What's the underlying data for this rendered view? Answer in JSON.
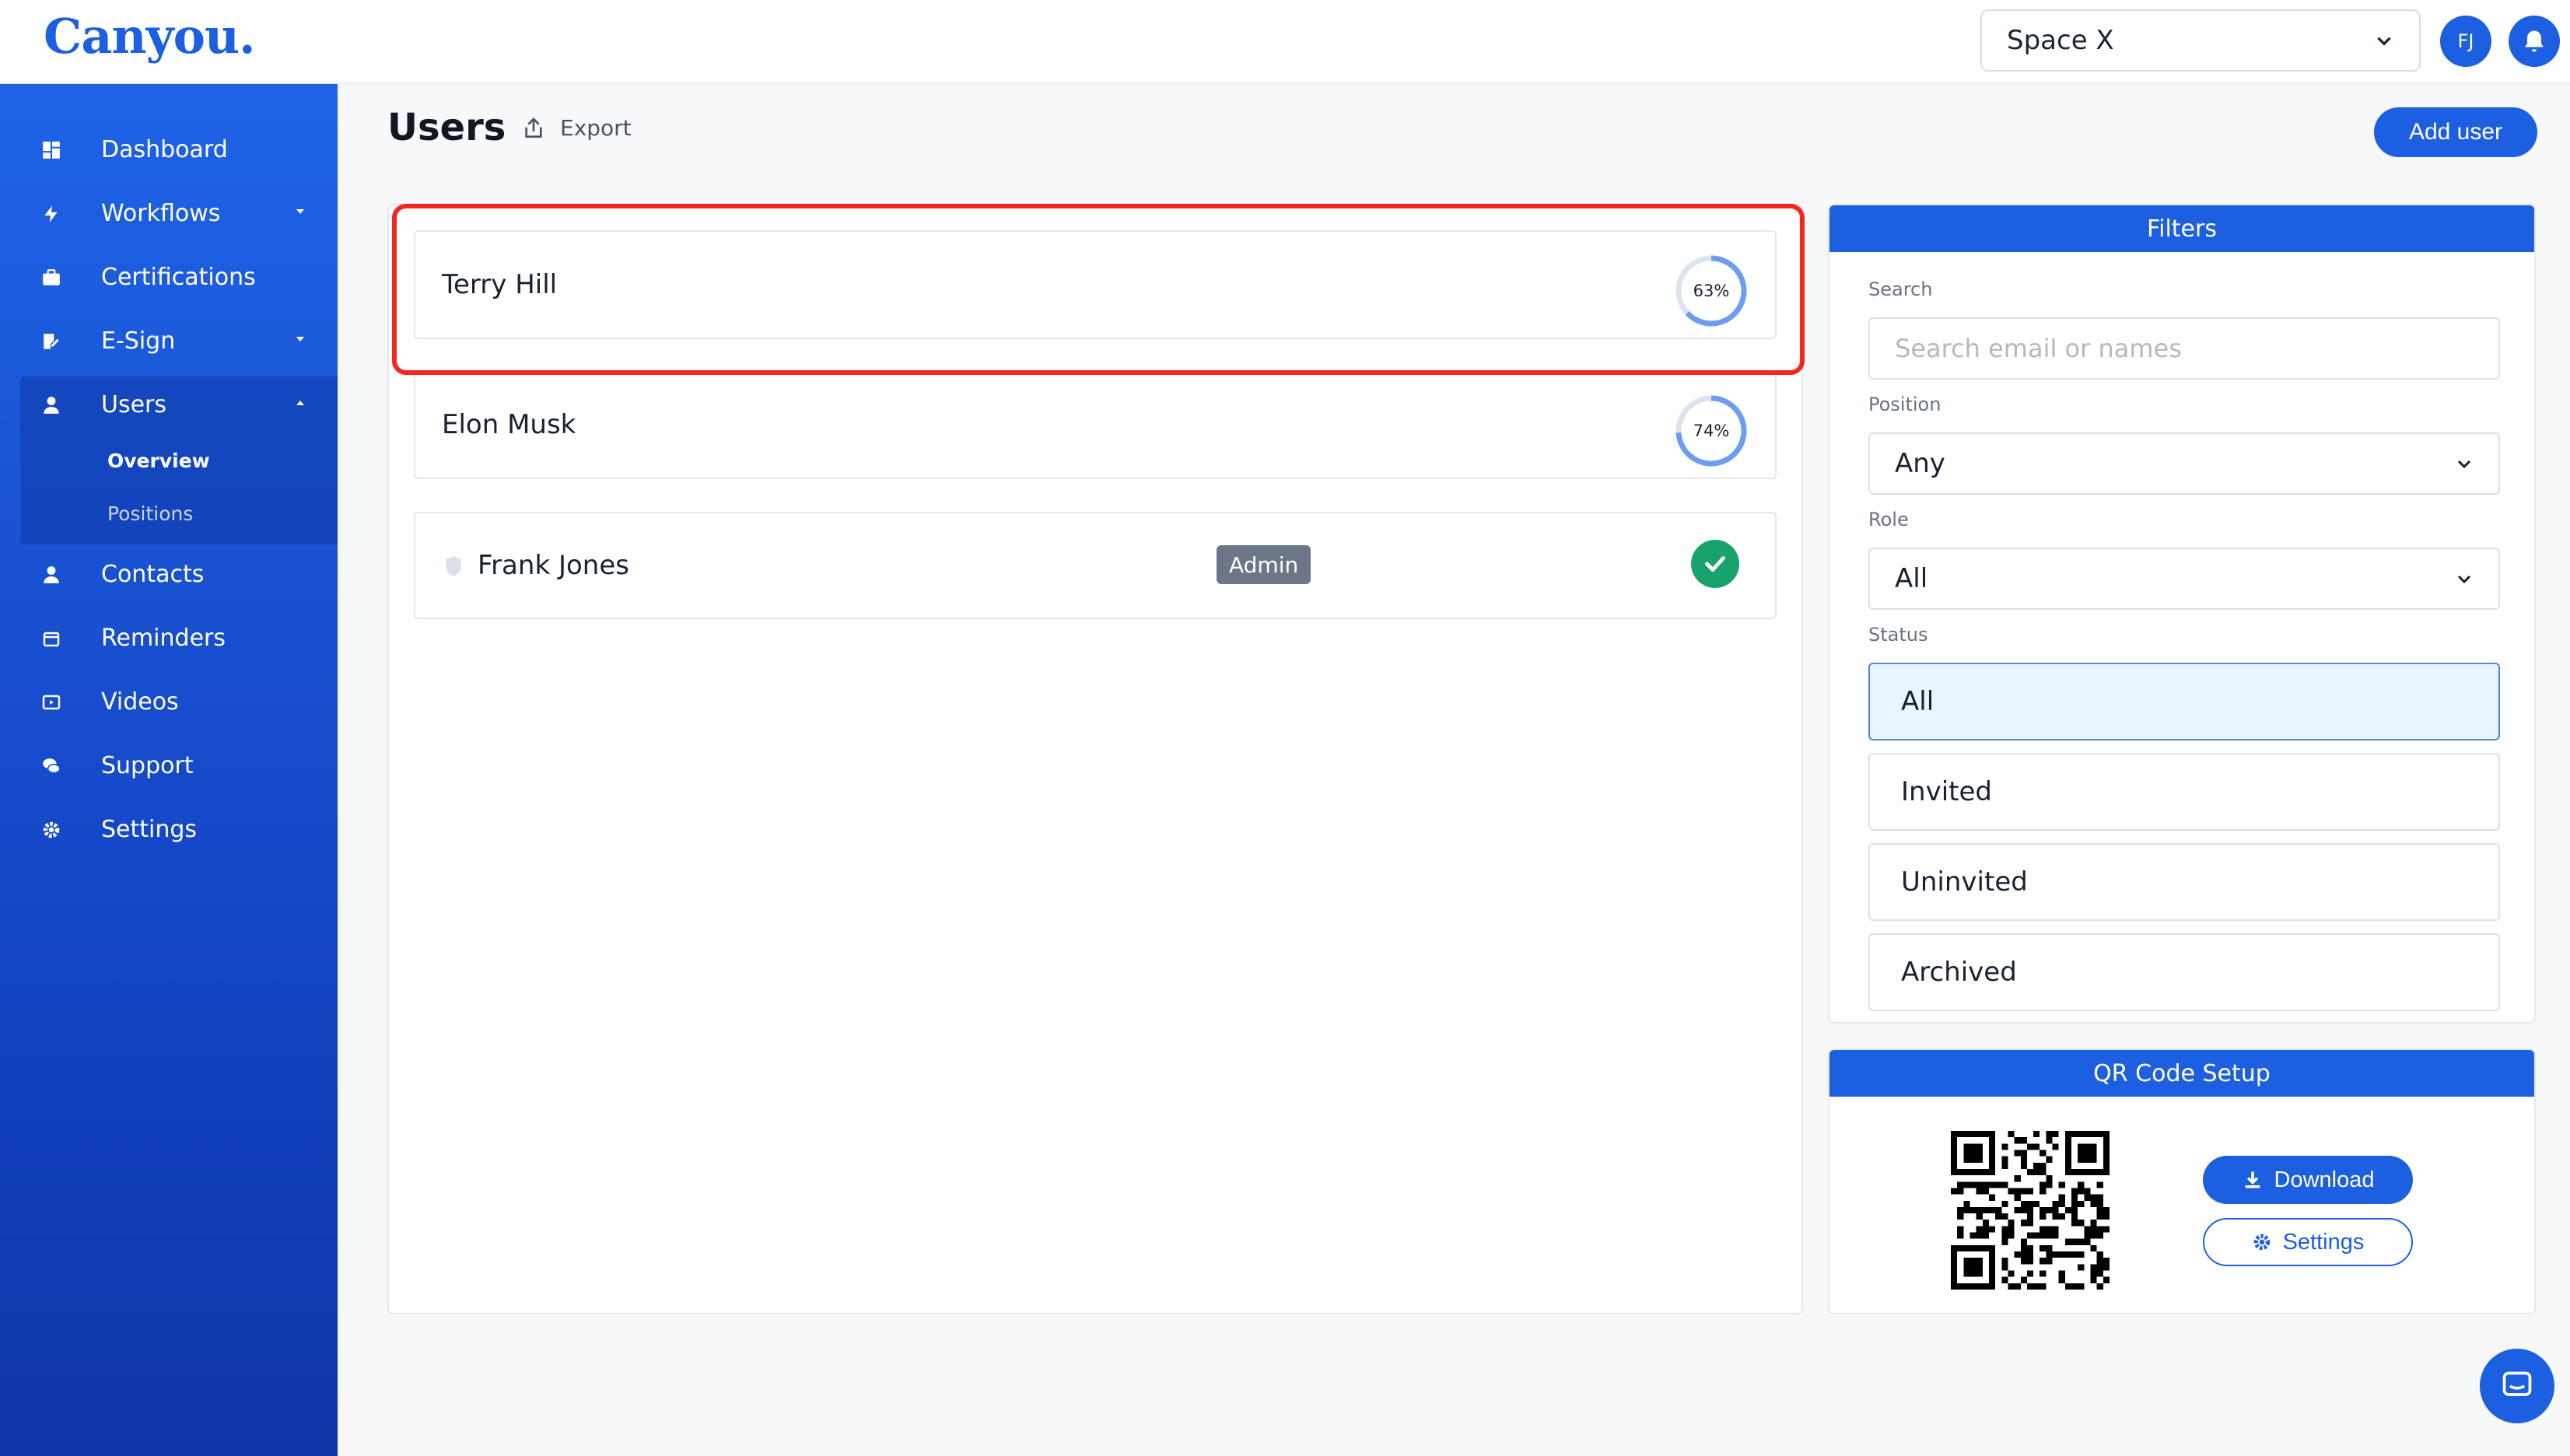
{
  "app": {
    "logo": "Canyou."
  },
  "header": {
    "space_select": "Space X",
    "avatar_initials": "FJ",
    "icons": [
      "chevron-down-icon",
      "bell-icon"
    ]
  },
  "sidebar": {
    "items": [
      {
        "label": "Dashboard",
        "icon": "dashboard-icon"
      },
      {
        "label": "Workflows",
        "icon": "bolt-icon",
        "has_caret": true
      },
      {
        "label": "Certifications",
        "icon": "briefcase-icon"
      },
      {
        "label": "E-Sign",
        "icon": "signature-icon",
        "has_caret": true
      },
      {
        "label": "Users",
        "icon": "user-icon",
        "expanded": true
      },
      {
        "label": "Contacts",
        "icon": "contact-icon"
      },
      {
        "label": "Reminders",
        "icon": "calendar-icon"
      },
      {
        "label": "Videos",
        "icon": "video-icon"
      },
      {
        "label": "Support",
        "icon": "chat-icon"
      },
      {
        "label": "Settings",
        "icon": "gear-icon"
      }
    ],
    "users_sub": [
      {
        "label": "Overview",
        "active": true
      },
      {
        "label": "Positions",
        "active": false
      }
    ]
  },
  "main": {
    "title": "Users",
    "export_label": "Export",
    "add_user_label": "Add user",
    "users": [
      {
        "name": "Terry Hill",
        "progress": "63%",
        "progress_value": 0.63,
        "highlighted": true
      },
      {
        "name": "Elon Musk",
        "progress": "74%",
        "progress_value": 0.74
      },
      {
        "name": "Frank Jones",
        "badge": "Admin",
        "status": "complete"
      }
    ]
  },
  "filters": {
    "title": "Filters",
    "search_label": "Search",
    "search_placeholder": "Search email or names",
    "position_label": "Position",
    "position_value": "Any",
    "role_label": "Role",
    "role_value": "All",
    "status_label": "Status",
    "status_options": [
      "All",
      "Invited",
      "Uninvited",
      "Archived"
    ],
    "status_selected": "All"
  },
  "qr": {
    "title": "QR Code Setup",
    "download_label": "Download",
    "settings_label": "Settings"
  },
  "colors": {
    "brand": "#1c5fe0",
    "highlight": "#f5261e",
    "success": "#17a36b",
    "badge": "#6c7686"
  }
}
